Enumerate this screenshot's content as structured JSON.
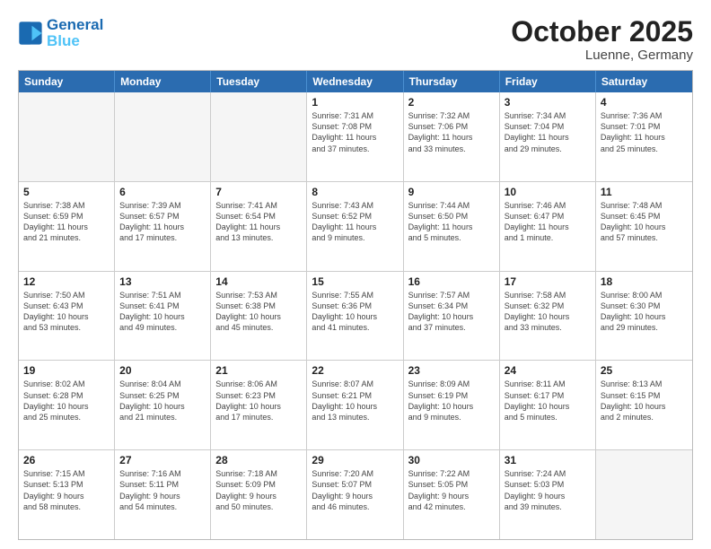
{
  "logo": {
    "text_general": "General",
    "text_blue": "Blue"
  },
  "header": {
    "month": "October 2025",
    "location": "Luenne, Germany"
  },
  "weekdays": [
    "Sunday",
    "Monday",
    "Tuesday",
    "Wednesday",
    "Thursday",
    "Friday",
    "Saturday"
  ],
  "rows": [
    [
      {
        "day": "",
        "info": ""
      },
      {
        "day": "",
        "info": ""
      },
      {
        "day": "",
        "info": ""
      },
      {
        "day": "1",
        "info": "Sunrise: 7:31 AM\nSunset: 7:08 PM\nDaylight: 11 hours\nand 37 minutes."
      },
      {
        "day": "2",
        "info": "Sunrise: 7:32 AM\nSunset: 7:06 PM\nDaylight: 11 hours\nand 33 minutes."
      },
      {
        "day": "3",
        "info": "Sunrise: 7:34 AM\nSunset: 7:04 PM\nDaylight: 11 hours\nand 29 minutes."
      },
      {
        "day": "4",
        "info": "Sunrise: 7:36 AM\nSunset: 7:01 PM\nDaylight: 11 hours\nand 25 minutes."
      }
    ],
    [
      {
        "day": "5",
        "info": "Sunrise: 7:38 AM\nSunset: 6:59 PM\nDaylight: 11 hours\nand 21 minutes."
      },
      {
        "day": "6",
        "info": "Sunrise: 7:39 AM\nSunset: 6:57 PM\nDaylight: 11 hours\nand 17 minutes."
      },
      {
        "day": "7",
        "info": "Sunrise: 7:41 AM\nSunset: 6:54 PM\nDaylight: 11 hours\nand 13 minutes."
      },
      {
        "day": "8",
        "info": "Sunrise: 7:43 AM\nSunset: 6:52 PM\nDaylight: 11 hours\nand 9 minutes."
      },
      {
        "day": "9",
        "info": "Sunrise: 7:44 AM\nSunset: 6:50 PM\nDaylight: 11 hours\nand 5 minutes."
      },
      {
        "day": "10",
        "info": "Sunrise: 7:46 AM\nSunset: 6:47 PM\nDaylight: 11 hours\nand 1 minute."
      },
      {
        "day": "11",
        "info": "Sunrise: 7:48 AM\nSunset: 6:45 PM\nDaylight: 10 hours\nand 57 minutes."
      }
    ],
    [
      {
        "day": "12",
        "info": "Sunrise: 7:50 AM\nSunset: 6:43 PM\nDaylight: 10 hours\nand 53 minutes."
      },
      {
        "day": "13",
        "info": "Sunrise: 7:51 AM\nSunset: 6:41 PM\nDaylight: 10 hours\nand 49 minutes."
      },
      {
        "day": "14",
        "info": "Sunrise: 7:53 AM\nSunset: 6:38 PM\nDaylight: 10 hours\nand 45 minutes."
      },
      {
        "day": "15",
        "info": "Sunrise: 7:55 AM\nSunset: 6:36 PM\nDaylight: 10 hours\nand 41 minutes."
      },
      {
        "day": "16",
        "info": "Sunrise: 7:57 AM\nSunset: 6:34 PM\nDaylight: 10 hours\nand 37 minutes."
      },
      {
        "day": "17",
        "info": "Sunrise: 7:58 AM\nSunset: 6:32 PM\nDaylight: 10 hours\nand 33 minutes."
      },
      {
        "day": "18",
        "info": "Sunrise: 8:00 AM\nSunset: 6:30 PM\nDaylight: 10 hours\nand 29 minutes."
      }
    ],
    [
      {
        "day": "19",
        "info": "Sunrise: 8:02 AM\nSunset: 6:28 PM\nDaylight: 10 hours\nand 25 minutes."
      },
      {
        "day": "20",
        "info": "Sunrise: 8:04 AM\nSunset: 6:25 PM\nDaylight: 10 hours\nand 21 minutes."
      },
      {
        "day": "21",
        "info": "Sunrise: 8:06 AM\nSunset: 6:23 PM\nDaylight: 10 hours\nand 17 minutes."
      },
      {
        "day": "22",
        "info": "Sunrise: 8:07 AM\nSunset: 6:21 PM\nDaylight: 10 hours\nand 13 minutes."
      },
      {
        "day": "23",
        "info": "Sunrise: 8:09 AM\nSunset: 6:19 PM\nDaylight: 10 hours\nand 9 minutes."
      },
      {
        "day": "24",
        "info": "Sunrise: 8:11 AM\nSunset: 6:17 PM\nDaylight: 10 hours\nand 5 minutes."
      },
      {
        "day": "25",
        "info": "Sunrise: 8:13 AM\nSunset: 6:15 PM\nDaylight: 10 hours\nand 2 minutes."
      }
    ],
    [
      {
        "day": "26",
        "info": "Sunrise: 7:15 AM\nSunset: 5:13 PM\nDaylight: 9 hours\nand 58 minutes."
      },
      {
        "day": "27",
        "info": "Sunrise: 7:16 AM\nSunset: 5:11 PM\nDaylight: 9 hours\nand 54 minutes."
      },
      {
        "day": "28",
        "info": "Sunrise: 7:18 AM\nSunset: 5:09 PM\nDaylight: 9 hours\nand 50 minutes."
      },
      {
        "day": "29",
        "info": "Sunrise: 7:20 AM\nSunset: 5:07 PM\nDaylight: 9 hours\nand 46 minutes."
      },
      {
        "day": "30",
        "info": "Sunrise: 7:22 AM\nSunset: 5:05 PM\nDaylight: 9 hours\nand 42 minutes."
      },
      {
        "day": "31",
        "info": "Sunrise: 7:24 AM\nSunset: 5:03 PM\nDaylight: 9 hours\nand 39 minutes."
      },
      {
        "day": "",
        "info": ""
      }
    ]
  ]
}
